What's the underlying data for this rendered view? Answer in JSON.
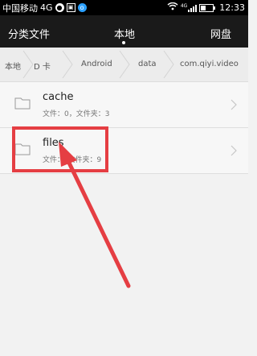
{
  "status_bar": {
    "carrier": "中国移动",
    "network": "4G",
    "signal_label": "4G",
    "time": "12:33",
    "icons": [
      "wechat-icon",
      "image-icon",
      "shield-icon",
      "wifi-icon",
      "signal-icon",
      "battery-icon"
    ]
  },
  "tabs": [
    {
      "label": "分类文件"
    },
    {
      "label": "本地"
    },
    {
      "label": "网盘"
    }
  ],
  "breadcrumb": [
    "本地",
    "D 卡",
    "Android",
    "data",
    "com.qiyi.video"
  ],
  "folders": [
    {
      "name": "cache",
      "meta": "文件：0，文件夹：3"
    },
    {
      "name": "files",
      "meta": "文件：，文件夹：9"
    }
  ],
  "annotation": {
    "color": "#e53e43"
  }
}
